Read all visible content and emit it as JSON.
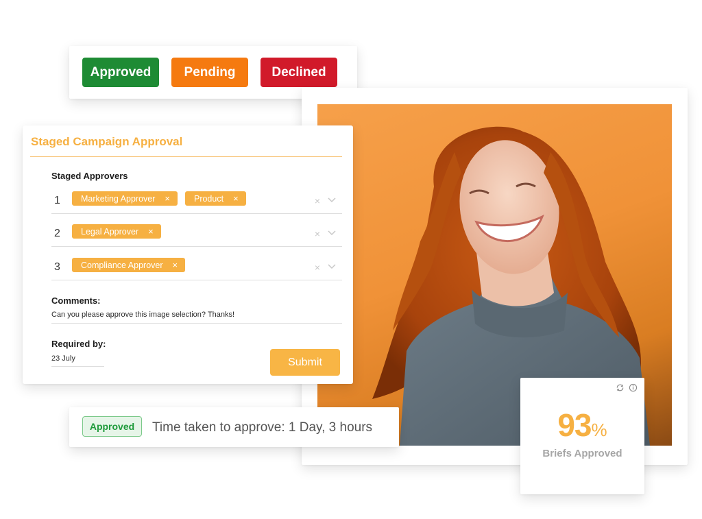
{
  "status_buttons": [
    {
      "label": "Approved",
      "color": "#1e8b34"
    },
    {
      "label": "Pending",
      "color": "#f57a10"
    },
    {
      "label": "Declined",
      "color": "#d11a2a"
    }
  ],
  "approval_form": {
    "title": "Staged Campaign Approval",
    "staged_approvers_label": "Staged Approvers",
    "stages": [
      {
        "number": "1",
        "approvers": [
          "Marketing Approver",
          "Product"
        ]
      },
      {
        "number": "2",
        "approvers": [
          "Legal Approver"
        ]
      },
      {
        "number": "3",
        "approvers": [
          "Compliance Approver"
        ]
      }
    ],
    "chip_remove_icon": "×",
    "row_clear_icon": "×",
    "comments_label": "Comments:",
    "comments_value": "Can you please approve this image selection? Thanks!",
    "required_by_label": "Required by:",
    "required_by_value": "23 July",
    "submit_label": "Submit"
  },
  "time_card": {
    "badge": "Approved",
    "text": "Time taken to approve: 1 Day, 3 hours"
  },
  "metric_card": {
    "value": "93",
    "unit": "%",
    "label": "Briefs Approved",
    "icons": [
      "refresh-icon",
      "info-icon"
    ]
  },
  "photo": {
    "description": "Smiling woman with curly red hair in grey turtleneck against orange background",
    "background_color": "#f09238"
  },
  "colors": {
    "accent": "#f6b042",
    "approved": "#1e8b34",
    "pending": "#f57a10",
    "declined": "#d11a2a"
  }
}
